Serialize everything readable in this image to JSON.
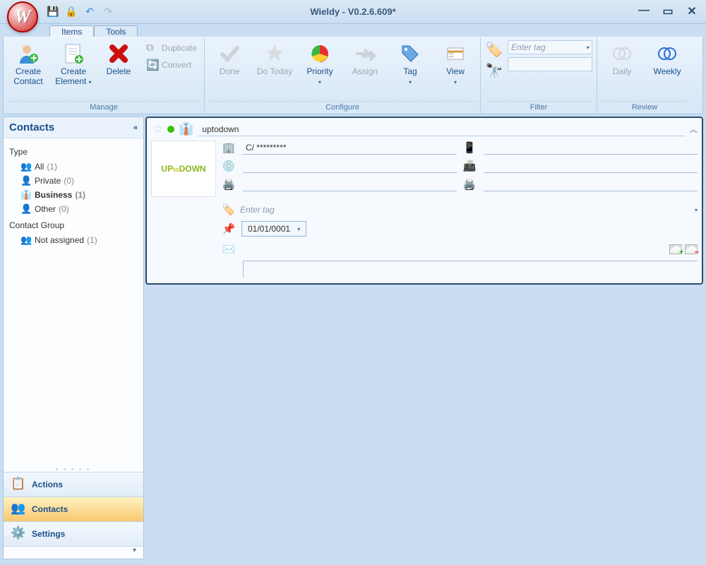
{
  "app_title": "Wieldy - V0.2.6.609*",
  "app_logo_letter": "W",
  "quick_access": {
    "save": "💾",
    "lock": "🔒",
    "undo": "↶",
    "redo": "↷"
  },
  "tabs": {
    "items": "Items",
    "tools": "Tools",
    "active": "items"
  },
  "ribbon": {
    "manage": {
      "label": "Manage",
      "create_contact": "Create Contact",
      "create_element": "Create Element",
      "delete": "Delete",
      "duplicate": "Duplicate",
      "convert": "Convert"
    },
    "configure": {
      "label": "Configure",
      "done": "Done",
      "do_today": "Do Today",
      "priority": "Priority",
      "assign": "Assign",
      "tag": "Tag",
      "view": "View"
    },
    "filter": {
      "label": "Filter",
      "enter_tag": "Enter tag"
    },
    "review": {
      "label": "Review",
      "daily": "Daily",
      "weekly": "Weekly"
    }
  },
  "sidebar": {
    "header": "Contacts",
    "type_label": "Type",
    "types": [
      {
        "label": "All",
        "count": "(1)",
        "bold": false,
        "icon": "👥"
      },
      {
        "label": "Private",
        "count": "(0)",
        "bold": false,
        "icon": "👤"
      },
      {
        "label": "Business",
        "count": "(1)",
        "bold": true,
        "icon": "👔"
      },
      {
        "label": "Other",
        "count": "(0)",
        "bold": false,
        "icon": "👤"
      }
    ],
    "group_label": "Contact Group",
    "groups": [
      {
        "label": "Not assigned",
        "count": "(1)",
        "icon": "👥"
      }
    ],
    "nav": {
      "actions": "Actions",
      "contacts": "Contacts",
      "settings": "Settings",
      "active": "contacts"
    }
  },
  "detail": {
    "name": "uptodown",
    "avatar_text_a": "UP",
    "avatar_text_b": "to",
    "avatar_text_c": "DOWN",
    "address": "C/ *********",
    "date": "01/01/0001",
    "enter_tag": "Enter tag"
  }
}
